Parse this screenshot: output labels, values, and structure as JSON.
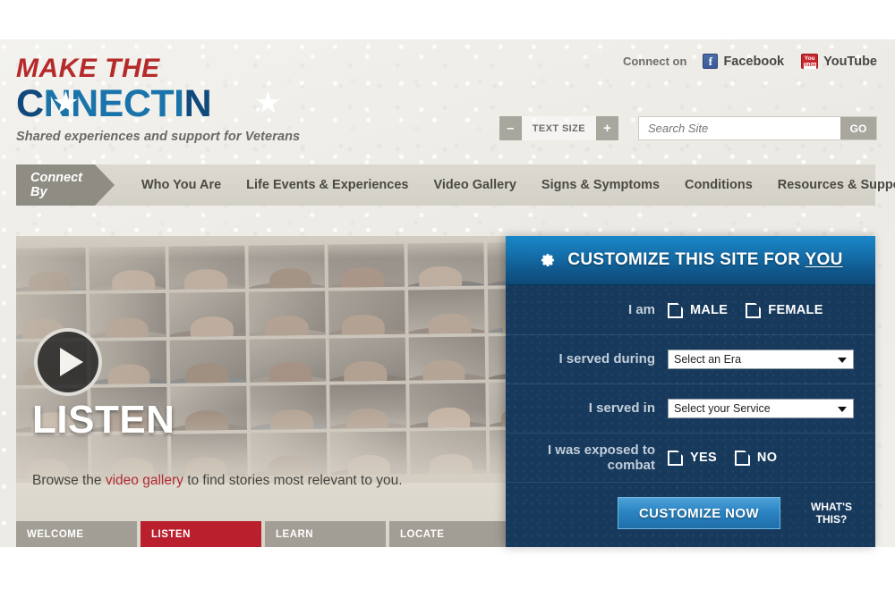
{
  "brand": {
    "line1": "MAKE THE",
    "line2_part1": "C",
    "line2_part2": "NNECTI",
    "line2_part3": "N",
    "tagline": "Shared experiences and support for Veterans"
  },
  "header": {
    "connect_on_label": "Connect on",
    "social": [
      {
        "name": "Facebook",
        "icon": "facebook-icon",
        "glyph": "f",
        "color": "#3b5998"
      },
      {
        "name": "YouTube",
        "icon": "youtube-icon",
        "glyph_top": "You",
        "glyph_bottom": "Tube",
        "color": "#c8262c"
      }
    ],
    "text_size": {
      "decrease": "–",
      "label": "TEXT SIZE",
      "increase": "+"
    },
    "search": {
      "placeholder": "Search Site",
      "value": "",
      "go_label": "GO"
    }
  },
  "nav": {
    "connect_by_label": "Connect By",
    "items": [
      {
        "label": "Who You Are"
      },
      {
        "label": "Life Events & Experiences"
      },
      {
        "label": "Video Gallery"
      },
      {
        "label": "Signs & Symptoms"
      },
      {
        "label": "Conditions"
      },
      {
        "label": "Resources & Support"
      }
    ]
  },
  "hero": {
    "title": "LISTEN",
    "caption_before": "Browse the ",
    "caption_link": "video gallery",
    "caption_after": " to find stories most relevant to you.",
    "play_icon": "play-icon",
    "tabs": [
      {
        "label": "WELCOME",
        "active": false
      },
      {
        "label": "LISTEN",
        "active": true
      },
      {
        "label": "LEARN",
        "active": false
      },
      {
        "label": "LOCATE",
        "active": false
      }
    ]
  },
  "panel": {
    "icon": "gear-icon",
    "title_main": "CUSTOMIZE THIS SITE FOR ",
    "title_emphasis": "YOU",
    "rows": [
      {
        "label": "I am",
        "type": "checkboxes",
        "options": [
          {
            "label": "MALE",
            "checked": false
          },
          {
            "label": "FEMALE",
            "checked": false
          }
        ]
      },
      {
        "label": "I served during",
        "type": "select",
        "value": "Select an Era"
      },
      {
        "label": "I served in",
        "type": "select",
        "value": "Select your Service"
      },
      {
        "label": "I was exposed to combat",
        "type": "checkboxes",
        "options": [
          {
            "label": "YES",
            "checked": false
          },
          {
            "label": "NO",
            "checked": false
          }
        ]
      }
    ],
    "submit_label": "CUSTOMIZE NOW",
    "whats_this_line1": "WHAT'S",
    "whats_this_line2": "THIS?"
  },
  "colors": {
    "brand_red": "#b52a2a",
    "brand_blue_dark": "#12497c",
    "brand_blue_mid": "#1a74ab",
    "panel_navy": "#17395c",
    "panel_header_blue": "#1572ae",
    "accent_red": "#ba1f2d",
    "paper": "#efeee9"
  }
}
